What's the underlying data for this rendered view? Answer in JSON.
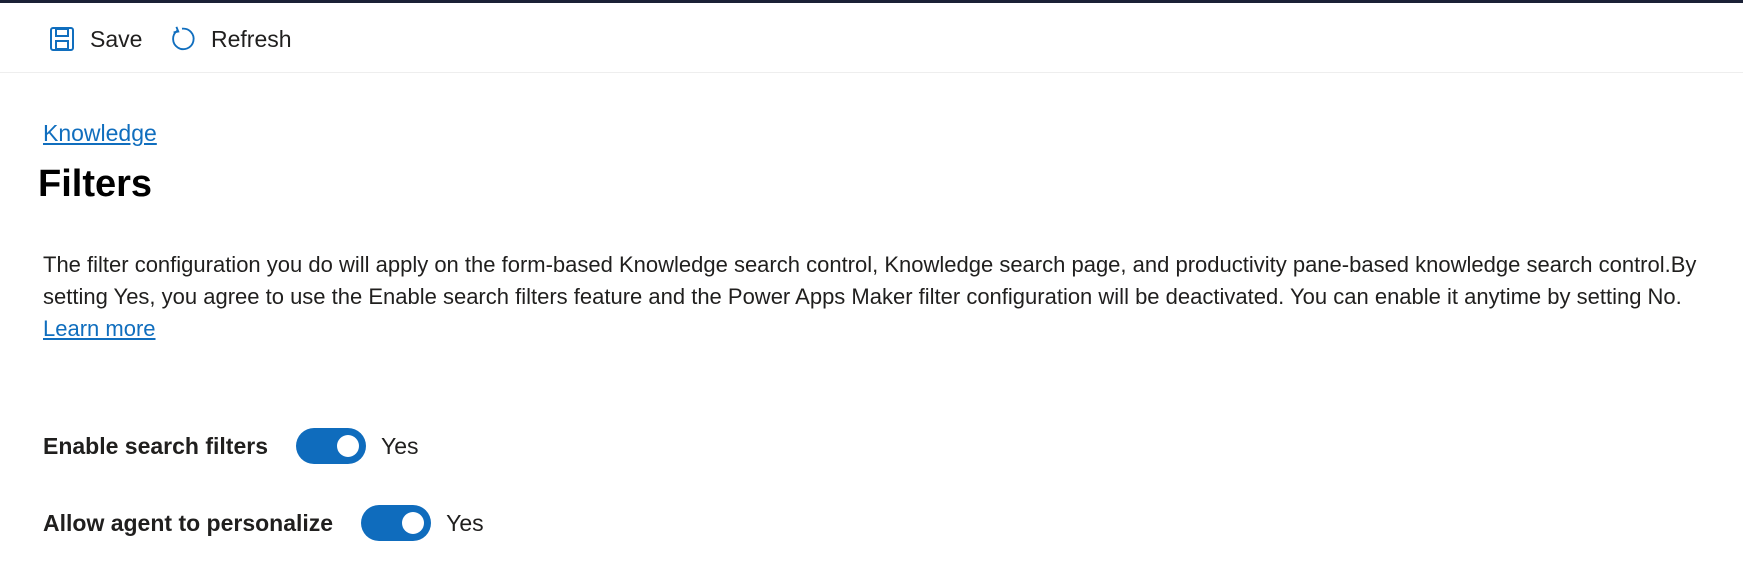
{
  "toolbar": {
    "save": {
      "label": "Save",
      "icon": "save-icon"
    },
    "refresh": {
      "label": "Refresh",
      "icon": "refresh-icon"
    }
  },
  "breadcrumb": {
    "label": "Knowledge"
  },
  "page": {
    "title": "Filters",
    "description": "The filter configuration you do will apply on the form-based Knowledge search control, Knowledge search page, and productivity pane-based knowledge search control.By setting Yes, you agree to use the Enable search filters feature and the Power Apps Maker filter configuration will be deactivated. You can enable it anytime by setting No.",
    "learn_more": "Learn more"
  },
  "settings": [
    {
      "label": "Enable search filters",
      "enabled": true,
      "state_text": "Yes"
    },
    {
      "label": "Allow agent to personalize",
      "enabled": true,
      "state_text": "Yes"
    }
  ],
  "colors": {
    "accent": "#0f6cbd",
    "link": "#106ebe",
    "top_border": "#1b2136"
  }
}
